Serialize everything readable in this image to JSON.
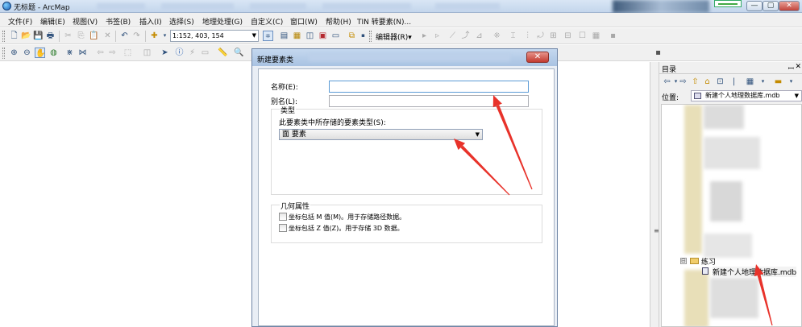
{
  "window": {
    "title": "无标题 - ArcMap",
    "controls": {
      "minimize": "—",
      "maximize": "▢",
      "close": "✕"
    }
  },
  "menu": [
    "文件(F)",
    "编辑(E)",
    "视图(V)",
    "书签(B)",
    "插入(I)",
    "选择(S)",
    "地理处理(G)",
    "自定义(C)",
    "窗口(W)",
    "帮助(H)",
    "TIN 转要素(N)..."
  ],
  "toolbar": {
    "scale": "1:152, 403, 154",
    "editor_label": "编辑器(R)▾"
  },
  "catalog": {
    "title": "目录",
    "pin": "ꟷ",
    "close": "✕",
    "location_label": "位置:",
    "location_value": "新建个人地理数据库.mdb",
    "tree": {
      "folder_name": "练习",
      "database_name": "新建个人地理数据库.mdb",
      "folder_toggle": "⊟"
    }
  },
  "dialog": {
    "title": "新建要素类",
    "close": "✕",
    "name_label": "名称(E):",
    "name_value": "",
    "alias_label": "别名(L):",
    "alias_value": "",
    "type_group_label": "类型",
    "type_prompt": "此要素类中所存储的要素类型(S):",
    "type_selected": "面 要素",
    "geometry_group_label": "几何属性",
    "check_m_label": "坐标包括 M 值(M)。用于存储路径数据。",
    "check_m_checked": false,
    "check_z_label": "坐标包括 Z 值(Z)。用于存储 3D 数据。",
    "check_z_checked": false
  },
  "colors": {
    "annotation_arrow": "#e8322a",
    "titlebar": "#c4d6ec",
    "dialog_close": "#c33a30"
  }
}
